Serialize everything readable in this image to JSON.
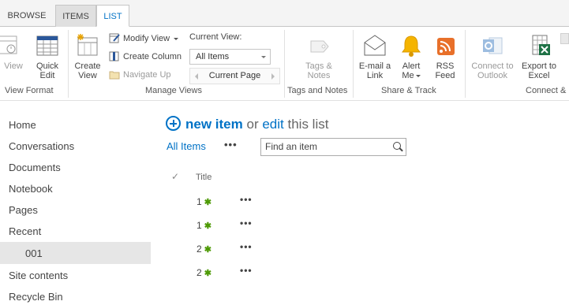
{
  "tabs": [
    "BROWSE",
    "ITEMS",
    "LIST"
  ],
  "ribbon": {
    "view_format": {
      "view": "View",
      "quick_edit": "Quick\nEdit",
      "group": "View Format"
    },
    "manage_views": {
      "create_view": "Create\nView",
      "modify_view": "Modify View",
      "create_column": "Create Column",
      "navigate_up": "Navigate Up",
      "current_view_label": "Current View:",
      "current_view_value": "All Items",
      "current_page": "Current Page",
      "group": "Manage Views"
    },
    "tags_notes": {
      "tags_notes": "Tags &\nNotes",
      "group": "Tags and Notes"
    },
    "share_track": {
      "email_link": "E-mail a\nLink",
      "alert_me": "Alert\nMe",
      "rss_feed": "RSS\nFeed",
      "group": "Share & Track"
    },
    "connect_export": {
      "connect_outlook": "Connect to\nOutlook",
      "export_excel": "Export to\nExcel",
      "group": "Connect &"
    }
  },
  "nav": [
    "Home",
    "Conversations",
    "Documents",
    "Notebook",
    "Pages",
    "Recent",
    "001",
    "Site contents",
    "Recycle Bin"
  ],
  "main": {
    "new_item": "new item",
    "or": "or",
    "edit": "edit",
    "this_list": "this list",
    "all_items": "All Items",
    "search_placeholder": "Find an item",
    "col_title": "Title",
    "rows": [
      "1",
      "1",
      "2",
      "2"
    ],
    "new_marker": "✱"
  },
  "colors": {
    "accent": "#0072c6",
    "new_marker": "#4e9a06"
  }
}
